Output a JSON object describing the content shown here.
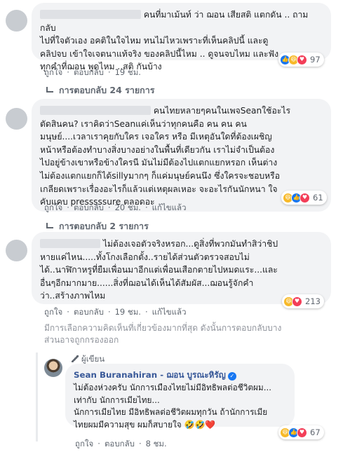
{
  "comments": [
    {
      "text_lines": [
        "คนที่มาเม้นท์ ว่า ฌอน เสียสติ แตกดัน .. ถามกลับ",
        "ไปที่ใจตัวเอง อคติในใจไหม ทนไม่ไหวเพราะที่เห็นคลิปนี้ และดู",
        "คลิปจบ เข้าใจเจตนาแท้จริง ของคลิปนี้ไหม .. ดูจนจบไหม และฟัง",
        "ทุกคำที่ฌอน พูดไหม ..สติ กันบ้าง"
      ],
      "like": "ถูกใจ",
      "reply": "ตอบกลับ",
      "time": "19 ชม.",
      "reactions_count": "97",
      "replies_link": "การตอบกลับ 24 รายการ"
    },
    {
      "text_lines": [
        "คนไทยหลายๆคนในเพจSeanใช้อะไร",
        "ตัดสินคน? เราคิดว่าSeanแค่เห็นว่าทุกคนคือ คน คน คน",
        "มนุษย์....เวลาเราคุยกับใคร เจอใคร หรือ มีเหตุอันใดที่ต้องเผชิญ",
        "หน้าหรือต้องทำบางสิ่งบางอย่างในพื้นที่เดียวกัน เราไม่จำเป็นต้อง",
        "ไปอยู่ข้างเขาหรือข้างใครนี มันไม่มีต้องไปแตกแยกหรอก เห็นต่าง",
        "ไม่ต้องแตกแยกก็ได้sillyมากๆ ก็แค่มนุษย์คนนึง ซึ่งใครจะชอบหรือ",
        "เกลียดเพราะเรื่องอะไรก็แล้วแต่เหตุผลเหอะ จะอะไรกันนักหนา ใจ",
        "คับแคบ presssssure ตลอดอะ"
      ],
      "like": "ถูกใจ",
      "reply": "ตอบกลับ",
      "time": "20 ชม.",
      "edited": "แก้ไขแล้ว",
      "reactions_count": "61",
      "replies_link": "การตอบกลับ 2 รายการ"
    },
    {
      "text_lines": [
        "ไม่ต้องเจอตัวจริงหรอก...ดูสิ่งที่พวกมันทำสิว่าชิป",
        "หายแค่ไหน.....ทั้งโกงเลือกตั้ง..รายได้ส่วนตัวตรวจสอบไม่",
        "ได้..นาฬิกาหรูที่ยืมเพื่อนมาอีกแต่เพื่อนเสือกตายไปหมดแระ...และ",
        "อื่นๆอีกมากมาย......สิ่งที่ฌอนได้เห็นได้สัมผัส...ฌอนรู้จักคำ",
        "ว่า..สร้างภาพไหม"
      ],
      "like": "ถูกใจ",
      "reply": "ตอบกลับ",
      "time": "19 ชม.",
      "edited": "แก้ไขแล้ว",
      "reactions_count": "213"
    }
  ],
  "filter_notice": [
    "มีการเลือกความคิดเห็นที่เกี่ยวข้องมากที่สุด ดังนั้นการตอบกลับบาง",
    "ส่วนอาจถูกกรองออก"
  ],
  "reply": {
    "author_tag": "ผู้เขียน",
    "author": "Sean Buranahiran - ฌอน บูรณะหิรัญ",
    "text_lines": [
      "ไม่ต้องห่วงครับ นักการเมืองไทยไม่มีอิทธิพลต่อชีวิตผม...",
      "เท่ากับ นักการเมียไทย...",
      "นักการเมียไทย มีอิทธิพลต่อชีวิตผมทุกวัน ถ้านักการเมีย",
      "ไทยผมมีความสุข ผมก็สบายใจ"
    ],
    "trailing_emoji": "🤣🤣❤️",
    "like": "ถูกใจ",
    "reply": "ตอบกลับ",
    "time": "8 ชม.",
    "reactions_count": "67"
  },
  "colors": {
    "link_blue": "#385898",
    "meta_gray": "#606770",
    "bubble_bg": "#f2f3f5",
    "like_blue": "#1877f2",
    "haha_yellow": "#f7b928",
    "love_red": "#f33e58"
  }
}
